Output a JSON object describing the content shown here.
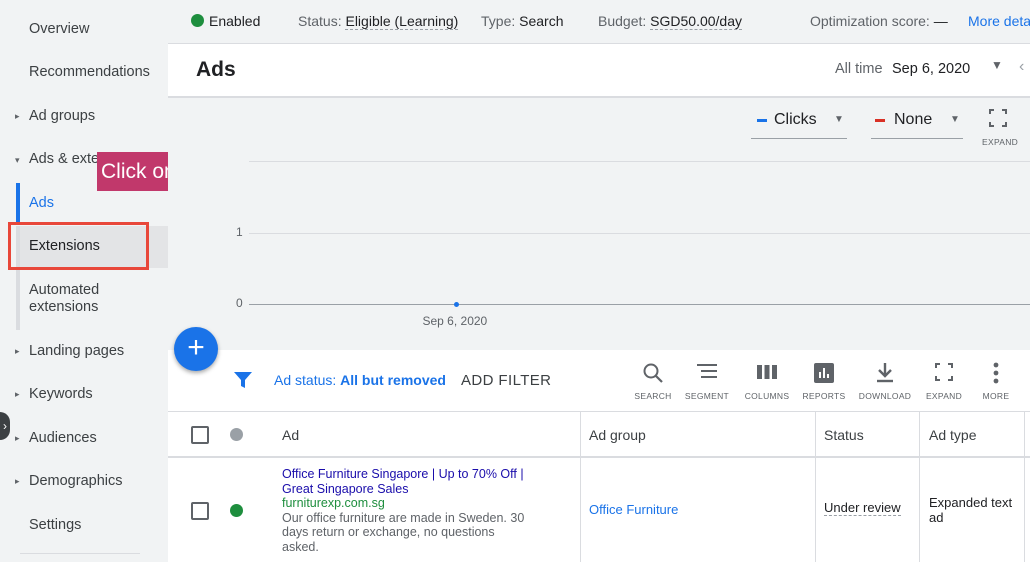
{
  "sidebar": {
    "items": [
      {
        "label": "Overview"
      },
      {
        "label": "Recommendations"
      },
      {
        "label": "Ad groups"
      },
      {
        "label": "Ads & exte"
      },
      {
        "label": "Ads"
      },
      {
        "label": "Extensions"
      },
      {
        "label": "Automated extensions"
      },
      {
        "label": "Landing pages"
      },
      {
        "label": "Keywords"
      },
      {
        "label": "Audiences"
      },
      {
        "label": "Demographics"
      },
      {
        "label": "Settings"
      }
    ]
  },
  "annotation": {
    "callout": "Click on ‘Extensions’"
  },
  "status_bar": {
    "enabled": "Enabled",
    "status_label": "Status:",
    "status_value": "Eligible (Learning)",
    "type_label": "Type:",
    "type_value": "Search",
    "budget_label": "Budget:",
    "budget_value": "SGD50.00/day",
    "optimization_label": "Optimization score:",
    "optimization_value": "—",
    "more_details": "More deta"
  },
  "header": {
    "title": "Ads",
    "date_range_label": "All time",
    "date_range_value": "Sep 6, 2020"
  },
  "chart_controls": {
    "metric1": "Clicks",
    "metric2": "None",
    "expand": "EXPAND",
    "metric1_color": "#1a73e8",
    "metric2_color": "#d93025"
  },
  "chart_data": {
    "type": "line",
    "x": [
      "Sep 6, 2020"
    ],
    "series": [
      {
        "name": "Clicks",
        "values": [
          0
        ]
      }
    ],
    "ylim": [
      0,
      1
    ],
    "yticks": [
      "0",
      "1"
    ],
    "xticks": [
      "Sep 6, 2020"
    ]
  },
  "filter": {
    "label": "Ad status:",
    "value": "All but removed",
    "add": "ADD FILTER"
  },
  "toolbar": {
    "search": "SEARCH",
    "segment": "SEGMENT",
    "columns": "COLUMNS",
    "reports": "REPORTS",
    "download": "DOWNLOAD",
    "expand": "EXPAND",
    "more": "MORE"
  },
  "table": {
    "headers": {
      "ad": "Ad",
      "ad_group": "Ad group",
      "status": "Status",
      "ad_type": "Ad type"
    },
    "rows": [
      {
        "headline1": "Office Furniture Singapore | Up to 70% Off |",
        "headline2": "Great Singapore Sales",
        "url": "furniturexp.com.sg",
        "desc1": "Our office furniture are made in Sweden. 30",
        "desc2": "days return or exchange, no questions",
        "desc3": "asked.",
        "ad_group": "Office Furniture",
        "status": "Under review",
        "ad_type1": "Expanded text",
        "ad_type2": "ad"
      }
    ]
  }
}
